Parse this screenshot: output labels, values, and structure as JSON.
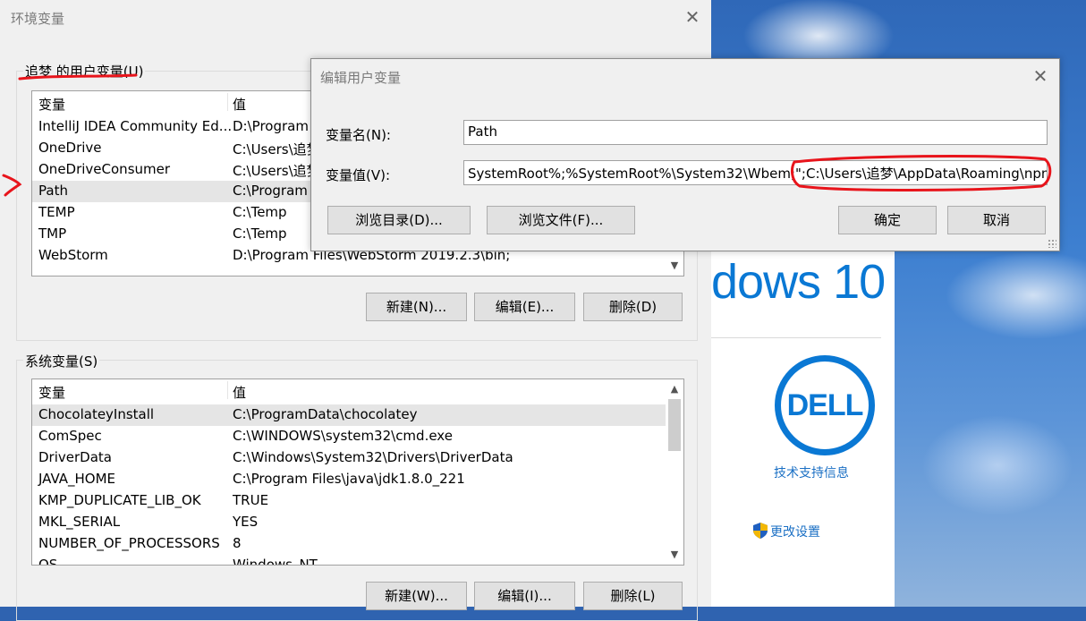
{
  "env_dialog": {
    "title": "环境变量",
    "user_group": {
      "label": "追梦 的用户变量(U)",
      "header": {
        "col1": "变量",
        "col2": "值"
      },
      "rows": [
        {
          "name": "IntelliJ IDEA Community Ed...",
          "value": "D:\\Program"
        },
        {
          "name": "OneDrive",
          "value": "C:\\Users\\追梦"
        },
        {
          "name": "OneDriveConsumer",
          "value": "C:\\Users\\追梦"
        },
        {
          "name": "Path",
          "value": "C:\\Program"
        },
        {
          "name": "TEMP",
          "value": "C:\\Temp"
        },
        {
          "name": "TMP",
          "value": "C:\\Temp"
        },
        {
          "name": "WebStorm",
          "value": "D:\\Program Files\\WebStorm 2019.2.3\\bin;"
        }
      ],
      "buttons": {
        "new": "新建(N)...",
        "edit": "编辑(E)...",
        "delete": "删除(D)"
      }
    },
    "system_group": {
      "label": "系统变量(S)",
      "header": {
        "col1": "变量",
        "col2": "值"
      },
      "rows": [
        {
          "name": "ChocolateyInstall",
          "value": "C:\\ProgramData\\chocolatey"
        },
        {
          "name": "ComSpec",
          "value": "C:\\WINDOWS\\system32\\cmd.exe"
        },
        {
          "name": "DriverData",
          "value": "C:\\Windows\\System32\\Drivers\\DriverData"
        },
        {
          "name": "JAVA_HOME",
          "value": "C:\\Program Files\\java\\jdk1.8.0_221"
        },
        {
          "name": "KMP_DUPLICATE_LIB_OK",
          "value": "TRUE"
        },
        {
          "name": "MKL_SERIAL",
          "value": "YES"
        },
        {
          "name": "NUMBER_OF_PROCESSORS",
          "value": "8"
        },
        {
          "name": "OS",
          "value": "Windows_NT"
        }
      ],
      "buttons": {
        "new": "新建(W)...",
        "edit": "编辑(I)...",
        "delete": "删除(L)"
      }
    }
  },
  "edit_dialog": {
    "title": "编辑用户变量",
    "name_label": "变量名(N):",
    "name_value": "Path",
    "value_label": "变量值(V):",
    "value_value": "SystemRoot%;%SystemRoot%\\System32\\Wbem;\";C:\\Users\\追梦\\AppData\\Roaming\\npm",
    "buttons": {
      "browse_dir": "浏览目录(D)...",
      "browse_file": "浏览文件(F)...",
      "ok": "确定",
      "cancel": "取消"
    }
  },
  "background": {
    "windows_brand": "dows 10",
    "oem_logo": "DELL",
    "support_link": "技术支持信息",
    "change_settings_link": "更改设置"
  },
  "colors": {
    "annotation_red": "#e8141b",
    "link_blue": "#1a6fc4",
    "windows_blue": "#0a78d4"
  }
}
